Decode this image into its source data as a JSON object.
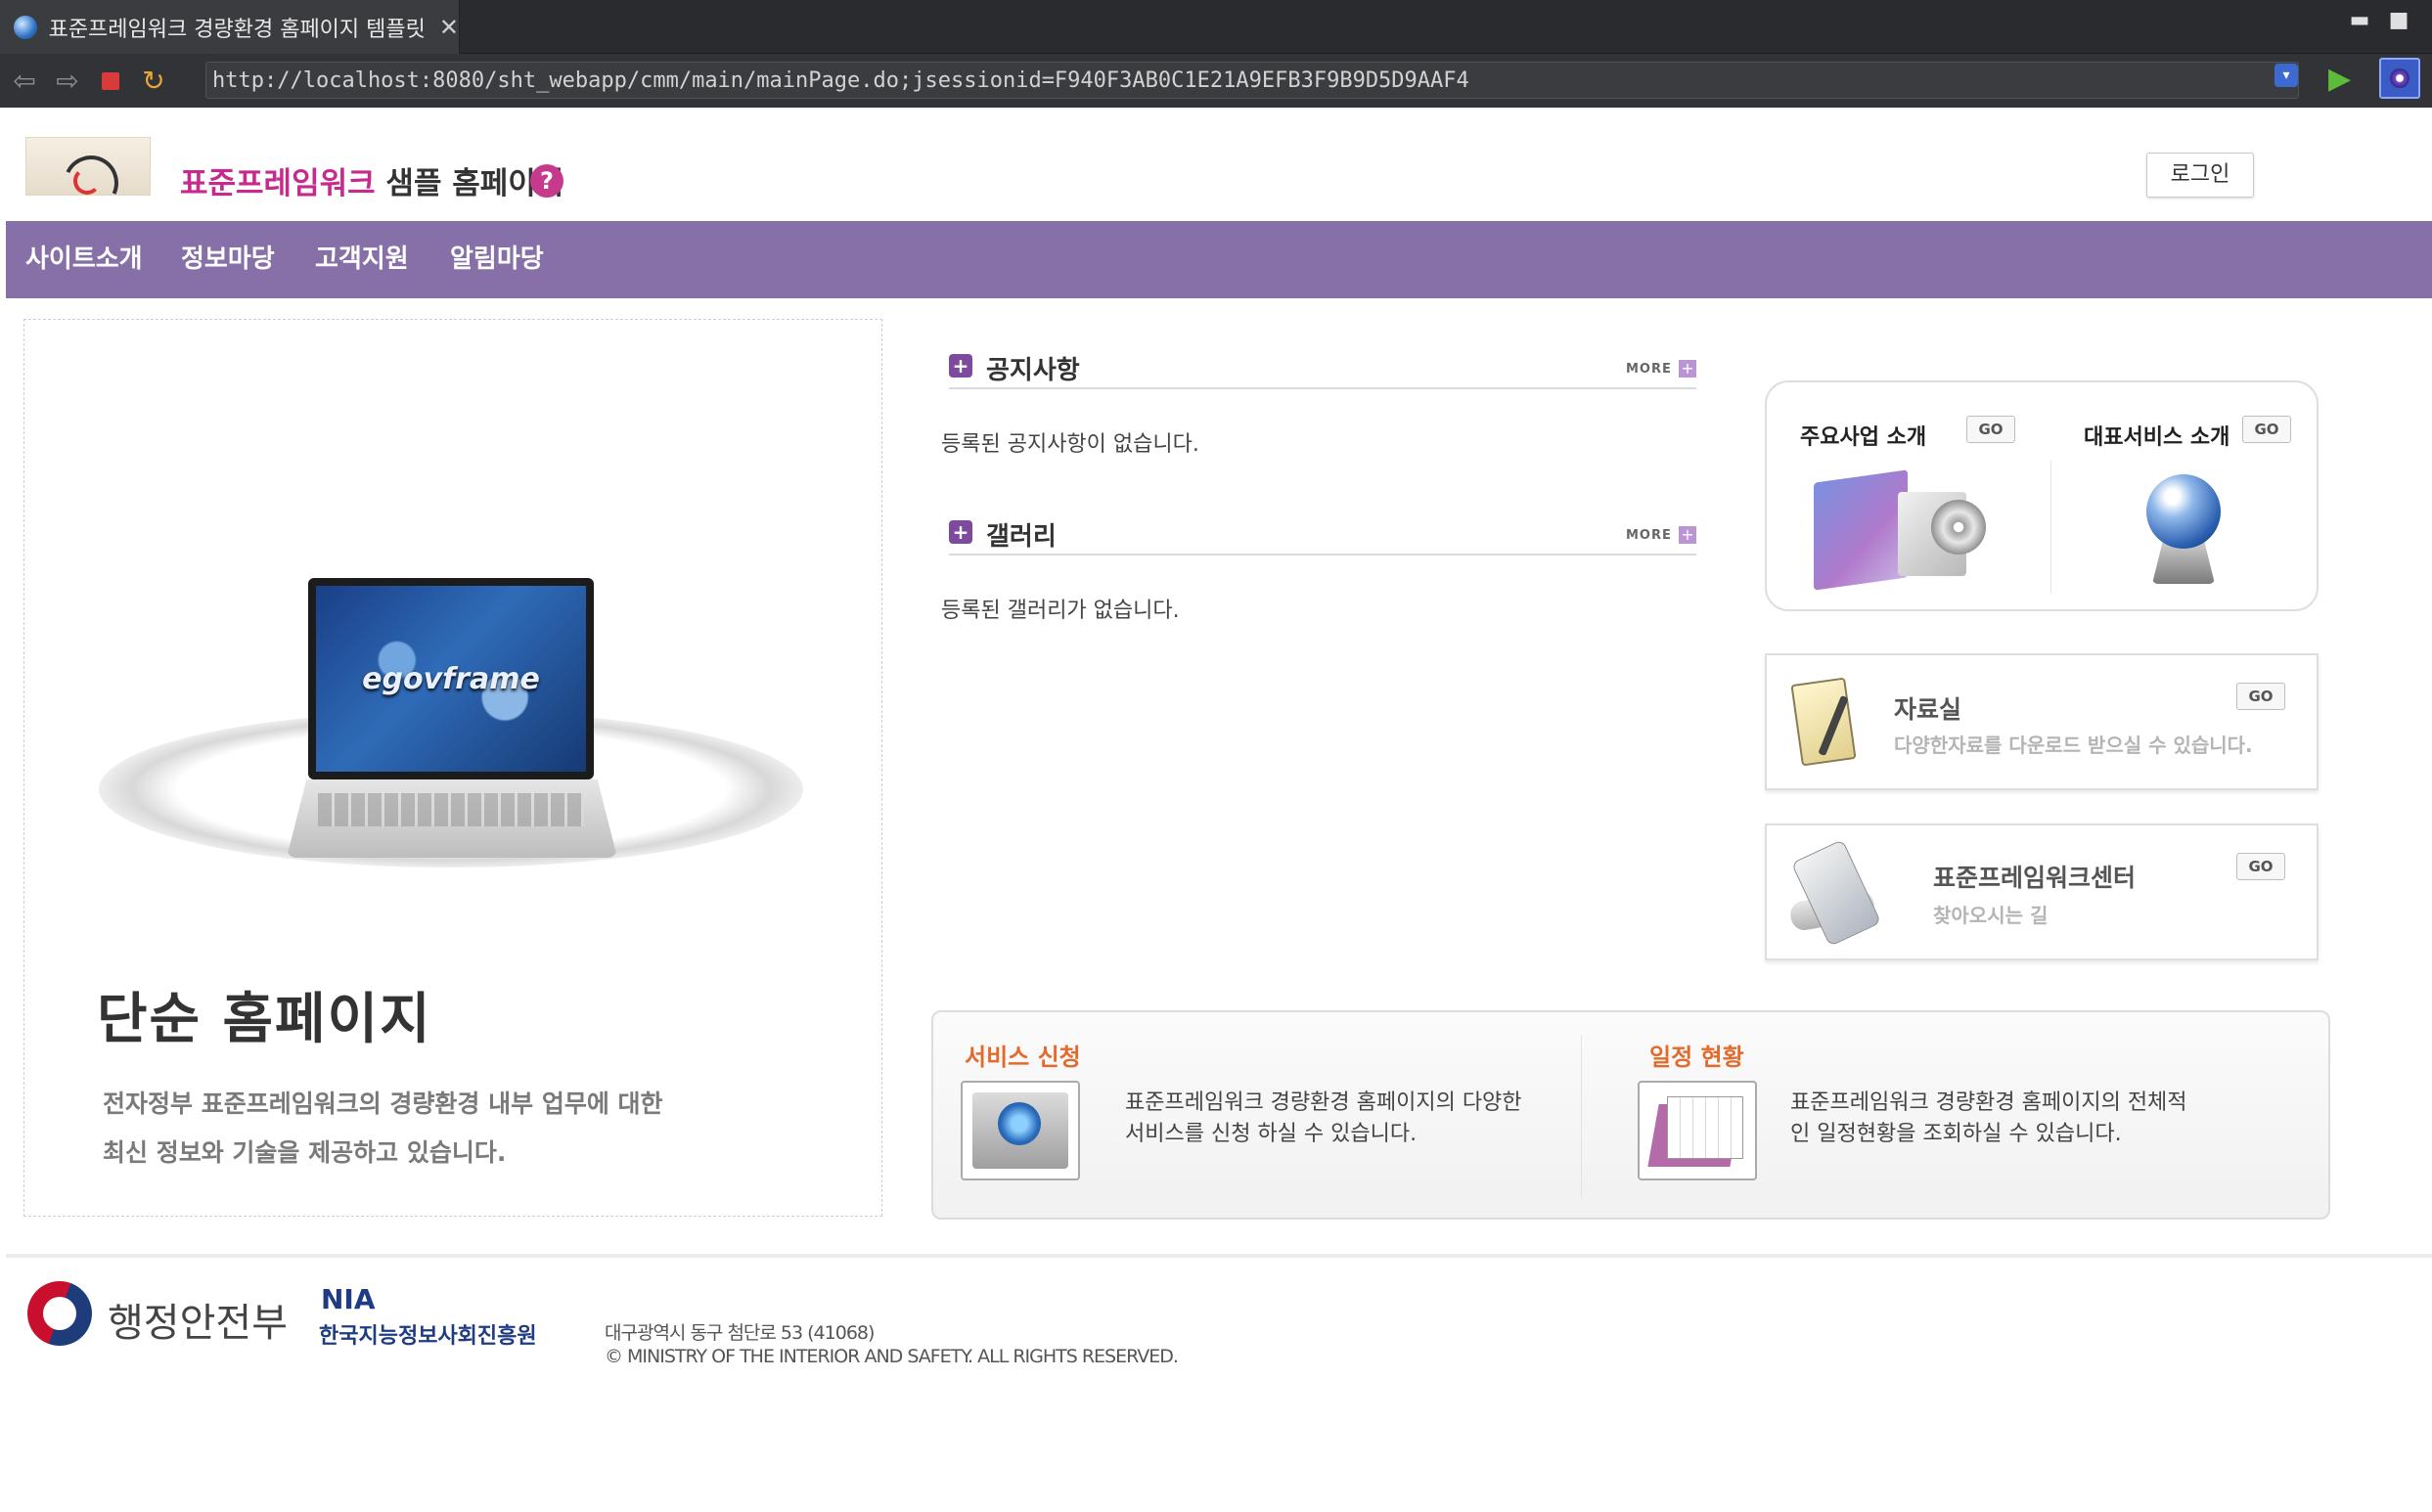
{
  "browser": {
    "tab_title": "표준프레임워크 경량환경 홈페이지 템플릿",
    "tab_close": "✕",
    "url": "http://localhost:8080/sht_webapp/cmm/main/mainPage.do;jsessionid=F940F3AB0C1E21A9EFB3F9B9D5D9AAF4",
    "icons": [
      "globe-icon",
      "back-icon",
      "forward-icon",
      "stop-icon",
      "refresh-icon",
      "go-icon",
      "menu-icon"
    ]
  },
  "header": {
    "title_brand": "표준프레임워크",
    "title_rest": " 샘플 홈페이지",
    "help_glyph": "?",
    "login_label": "로그인"
  },
  "menu": {
    "items": [
      "사이트소개",
      "정보마당",
      "고객지원",
      "알림마당"
    ]
  },
  "hero": {
    "laptop_text": "egovframe",
    "title": "단순 홈페이지",
    "desc_line1": "전자정부 표준프레임워크의 경량환경 내부 업무에 대한",
    "desc_line2": "최신 정보와 기술을 제공하고 있습니다."
  },
  "notice": {
    "title": "공지사항",
    "more": "MORE",
    "empty": "등록된 공지사항이 없습니다."
  },
  "gallery": {
    "title": "갤러리",
    "more": "MORE",
    "empty": "등록된 갤러리가 없습니다."
  },
  "biz": {
    "label1": "주요사업 소개",
    "label2": "대표서비스 소개",
    "go": "GO"
  },
  "data_room": {
    "title": "자료실",
    "subtitle": "다양한자료를 다운로드 받으실 수 있습니다.",
    "go": "GO"
  },
  "center": {
    "title": "표준프레임워크센터",
    "subtitle": "찾아오시는 길",
    "go": "GO"
  },
  "service": {
    "title": "서비스 신청",
    "desc_line1": "표준프레임워크 경량환경 홈페이지의 다양한",
    "desc_line2": "서비스를 신청 하실 수 있습니다."
  },
  "schedule": {
    "title": "일정 현황",
    "desc_line1": "표준프레임워크 경량환경 홈페이지의 전체적",
    "desc_line2": "인 일정현황을 조회하실 수 있습니다."
  },
  "footer": {
    "ministry": "행정안전부",
    "nia": "NIA",
    "nia_full": "한국지능정보사회진흥원",
    "address": "대구광역시 동구 첨단로 53 (41068)",
    "copyright": "© MINISTRY OF THE INTERIOR AND SAFETY. ALL RIGHTS RESERVED."
  }
}
